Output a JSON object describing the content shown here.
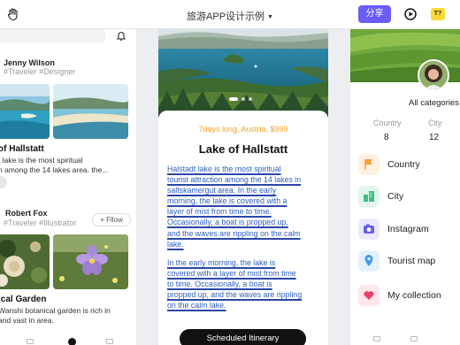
{
  "header": {
    "title": "旅游APP设计示例",
    "share_label": "分享",
    "t_badge": "T?"
  },
  "left_screen": {
    "users": [
      {
        "name": "Jenny Wilson",
        "tags": "#Traveler  #Designer"
      },
      {
        "name": "Robert Fox",
        "tags": "#Traveler #Illustrator",
        "follow_label": "+ Fllow"
      }
    ],
    "post_1": {
      "title": "of Hallstatt",
      "lines": [
        "t lake is the most spiritual",
        "n among the 14 lakes  area. the..."
      ]
    },
    "post_2": {
      "title": "ical Garden",
      "lines": [
        "Wanshi botanical garden is rich in",
        "and vast in area."
      ]
    }
  },
  "middle_screen": {
    "tour_tag": "7days long, Austria, $999",
    "title": "Lake of Hallstatt",
    "paragraph_1": [
      "Halstadt lake is the most spiritual",
      "tourist attraction among the 14 lakes in",
      "saltskamergut area. In the early",
      "morning, the lake is covered with a",
      "layer of mist from time to time.",
      "Occasionally, a boat is propped up,",
      "and the waves are rippling on the calm",
      "lake."
    ],
    "paragraph_2": [
      "In the early morning, the lake is",
      "covered with a layer of mist from time",
      "to time. Occasionally, a boat is",
      "propped up, and the waves are rippling",
      "on the calm lake."
    ],
    "cta_label": "Scheduled Itinerary"
  },
  "right_screen": {
    "all_categories": "All categories",
    "stats": [
      {
        "label": "Country",
        "value": "8"
      },
      {
        "label": "City",
        "value": "12"
      }
    ],
    "categories": [
      {
        "label": "Country",
        "icon": "flag-icon",
        "color": "#f7a23b",
        "bg": "#fff1e2"
      },
      {
        "label": "City",
        "icon": "city-icon",
        "color": "#3fbf86",
        "bg": "#e3f6ec"
      },
      {
        "label": "Instagram",
        "icon": "camera-icon",
        "color": "#6a5cf6",
        "bg": "#ece9fe"
      },
      {
        "label": "Tourist map",
        "icon": "map-pin-icon",
        "color": "#3d9cf0",
        "bg": "#e4f1fd"
      },
      {
        "label": "My collection",
        "icon": "heart-icon",
        "color": "#ee3f6a",
        "bg": "#fde6ec"
      }
    ]
  },
  "colors": {
    "accent": "#6a5cf6",
    "orange": "#f2a227",
    "link_blue": "#2d5fc2"
  }
}
